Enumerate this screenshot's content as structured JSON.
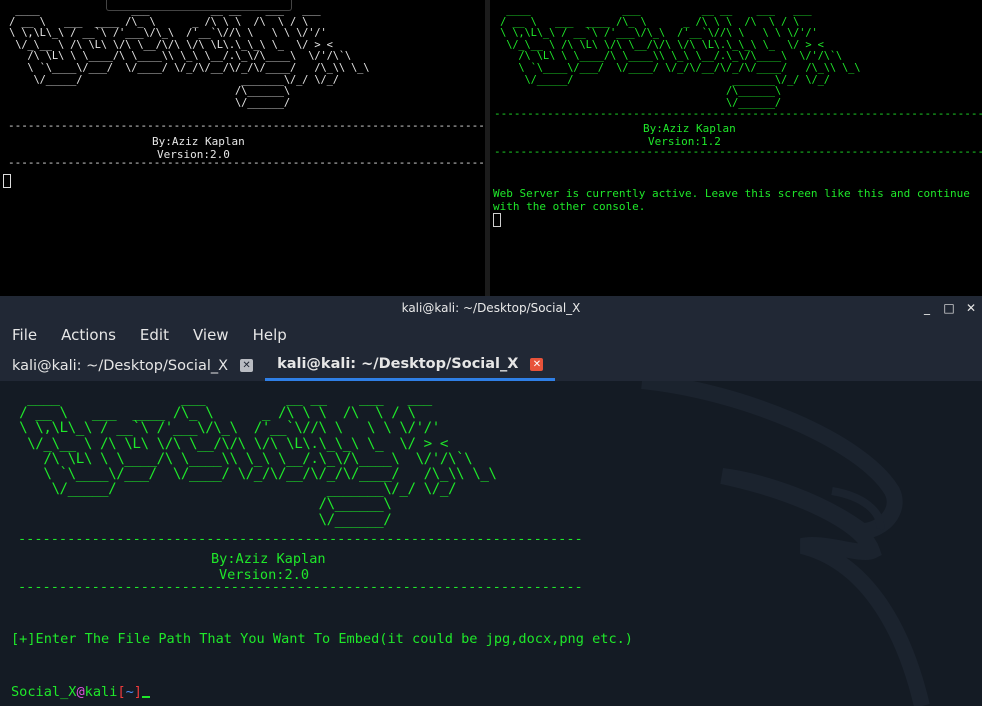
{
  "top_left_terminal": {
    "ascii_art": "  ____               ___          __ __    ___   ___\n / __ \\   ___  ____ /\\_ \\      _ /\\ \\ \\  /\\  \\ / \\\n \\ \\,\\L\\_\\ / __`\\ /'___\\/\\_\\  /'__`\\//\\ \\   \\ \\ \\/'/'\n  \\/_\\__ \\ /\\ \\L\\ \\/\\ \\__/\\/\\ \\/\\ \\L\\.\\_\\_\\ \\_  \\/ > <\n    /\\ \\L\\ \\ \\____/\\ \\____\\\\ \\_\\ \\__/.\\_\\/\\____\\  \\/'/\\`\\\n    \\ `\\____\\/___/  \\/____/ \\/_/\\/__/\\/_/\\/____/   /\\_\\\\ \\_\\\n     \\/_____/                          _______\\/_/ \\/_/\n                                      /\\______\\\n                                      \\/______/",
    "separator": "-------------------------------------------------------------------------------",
    "author": "By:Aziz Kaplan",
    "version": "Version:2.0"
  },
  "top_right_terminal": {
    "ascii_art": "  ____               ___          __ __    ___   ___\n / __ \\   ___  ____ /\\_ \\      _ /\\ \\ \\  /\\  \\ / \\\n \\ \\,\\L\\_\\ / __`\\ /'___\\/\\_\\  /'__`\\//\\ \\   \\ \\ \\/'/'\n  \\/_\\__ \\ /\\ \\L\\ \\/\\ \\__/\\/\\ \\/\\ \\L\\.\\_\\_\\ \\_  \\/ > <\n    /\\ \\L\\ \\ \\____/\\ \\____\\\\ \\_\\ \\__/.\\_\\/\\____\\  \\/'/\\`\\\n    \\ `\\____\\/___/  \\/____/ \\/_/\\/__/\\/_/\\/____/   /\\_\\\\ \\_\\\n     \\/_____/                          _______\\/_/ \\/_/\n                                      /\\______\\\n                                      \\/______/",
    "separator": "-------------------------------------------------------------------------------",
    "author": "By:Aziz Kaplan",
    "version": "Version:1.2",
    "status": "Web Server is currently active. Leave this screen like this and continue with the other console."
  },
  "window": {
    "title": "kali@kali: ~/Desktop/Social_X",
    "controls": {
      "minimize": "_",
      "maximize": "□",
      "close": "✕"
    },
    "menu": [
      "File",
      "Actions",
      "Edit",
      "View",
      "Help"
    ],
    "tabs": [
      {
        "label": "kali@kali: ~/Desktop/Social_X",
        "close": "✕"
      },
      {
        "label": "kali@kali: ~/Desktop/Social_X",
        "close": "✕"
      }
    ]
  },
  "main_terminal": {
    "ascii_art": "  ____               ___          __ __    ___   ___\n / __ \\   ___  ____ /\\_ \\      _ /\\ \\ \\  /\\  \\ / \\\n \\ \\,\\L\\_\\ / __`\\ /'___\\/\\_\\  /'__`\\//\\ \\   \\ \\ \\/'/'\n  \\/_\\__ \\ /\\ \\L\\ \\/\\ \\__/\\/\\ \\/\\ \\L\\.\\_\\_\\ \\_  \\/ > <\n    /\\ \\L\\ \\ \\____/\\ \\____\\\\ \\_\\ \\__/.\\_\\/\\____\\  \\/'/\\`\\\n    \\ `\\____\\/___/  \\/____/ \\/_/\\/__/\\/_/\\/____/   /\\_\\\\ \\_\\\n     \\/_____/                          _______\\/_/ \\/_/\n                                      /\\______\\\n                                      \\/______/",
    "separator": "---------------------------------------------------------------------",
    "author": "By:Aziz Kaplan",
    "version": "Version:2.0",
    "instruction": "[+]Enter The File Path That You Want To Embed(it could be jpg,docx,png etc.)",
    "prompt": {
      "user": "Social_X",
      "at": "@",
      "host": "kali",
      "open": "[",
      "path": "~",
      "close": "]"
    }
  },
  "colors": {
    "terminal_green": "#1fe82a",
    "tab_accent": "#2f7fe6",
    "window_bg": "#141b24",
    "chrome_bg": "#212835"
  }
}
